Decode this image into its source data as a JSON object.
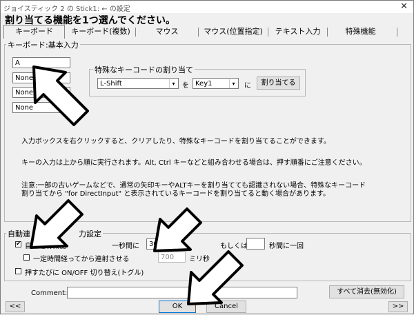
{
  "window": {
    "title": "ジョイスティック 2 の Stick1: ← の設定",
    "close_glyph": "✕"
  },
  "heading": "割り当てる機能を1つ選んでください。",
  "tabs": [
    "キーボード",
    "キーボード(複数)",
    "マウス",
    "マウス(位置指定)",
    "テキスト入力",
    "特殊機能"
  ],
  "keyboard_group": {
    "legend": "キーボード:基本入力",
    "inputs": [
      "A",
      "None",
      "None",
      "None"
    ],
    "special_group": {
      "legend": "特殊なキーコードの割り当て",
      "select1": "L-Shift",
      "wo": "を",
      "select2": "Key1",
      "ni": "に",
      "assign_button": "割り当てる"
    },
    "help1": "入力ボックスを右クリックすると、クリアしたり、特殊なキーコードを割り当てることができます。",
    "help2": "キーの入力は上から順に実行されます。Alt, Ctrl キーなどと組み合わせる場合は、押す順番にご注意ください。",
    "note_line1": "注意:一部の古いゲームなどで、通常の矢印キーやALTキーを割り当てても認識されない場合、特殊なキーコード",
    "note_line2": "割り当てから \"for DirectInput\" と表示されているキーコードを割り当てると動く場合があります。"
  },
  "auto_group": {
    "legend_part1": "自動連",
    "legend_part2": "力設定",
    "auto_fire_label": "自動連射機能",
    "auto_fire_checked": true,
    "per_second_label": "一秒間に",
    "per_second_value": "30",
    "per_second_unit": "回",
    "or_label": "もしくは",
    "seconds_value": "",
    "seconds_label": "秒間に一回",
    "delay_label": "一定時間経ってから連射させる",
    "delay_checked": false,
    "delay_value": "700",
    "delay_unit": "ミリ秒",
    "toggle_label": "押すたびに ON/OFF 切り替え(トグル)",
    "toggle_checked": false
  },
  "bottom": {
    "comment_label": "Comment:",
    "comment_value": "",
    "clear_all_button": "すべて消去(無効化)",
    "prev_button": "<<",
    "ok_button": "OK",
    "cancel_button": "Cancel",
    "next_button": ">>"
  },
  "colors": {
    "cursor_fill": "#ffffff",
    "cursor_stroke": "#000000"
  },
  "check_glyph": "✔",
  "select_arrow": "▾"
}
